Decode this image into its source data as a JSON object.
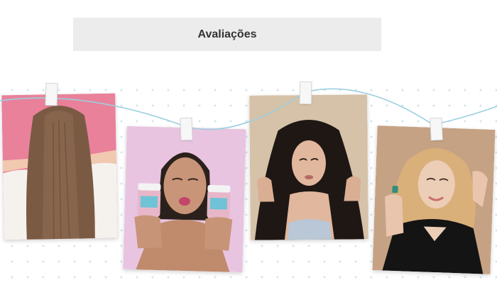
{
  "section": {
    "title": "Avaliações"
  },
  "photos": [
    {
      "name": "photo-long-straight-hair-back",
      "icon": "photo-image",
      "background": "#e77e98"
    },
    {
      "name": "photo-woman-with-gummy-jars",
      "icon": "photo-image",
      "background": "#e6c3de"
    },
    {
      "name": "photo-woman-long-dark-hair",
      "icon": "photo-image",
      "background": "#d8c6ad"
    },
    {
      "name": "photo-blonde-woman-black-dress",
      "icon": "photo-image",
      "background": "#c8a585"
    }
  ],
  "colors": {
    "header_bg": "#ececec",
    "title_text": "#333333",
    "string": "#9ccfe0",
    "dots": "#cfe6ec"
  }
}
